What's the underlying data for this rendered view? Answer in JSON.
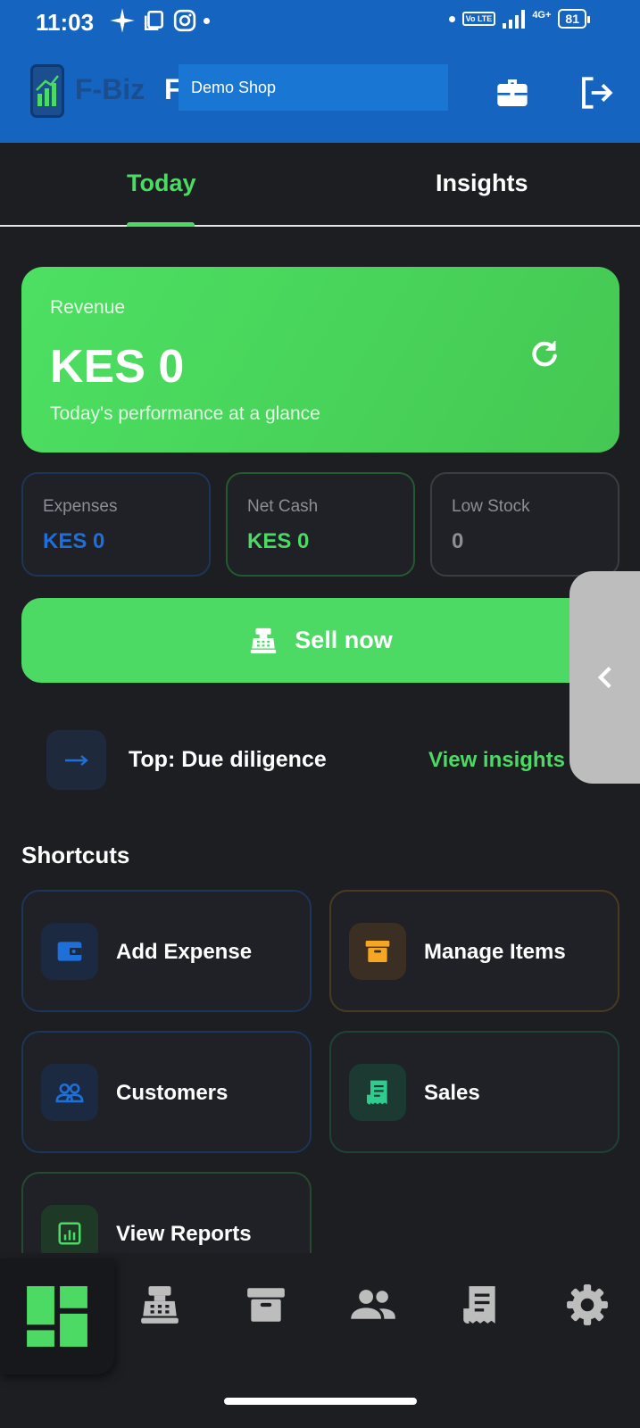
{
  "status_bar": {
    "time": "11:03",
    "volte_label": "Vo LTE",
    "network": "4G+",
    "battery": "81"
  },
  "app_bar": {
    "logo_text": "F-Biz",
    "title_initial": "F",
    "shop_name": "Demo Shop",
    "actions": [
      "briefcase-icon",
      "logout-icon"
    ]
  },
  "tabs": [
    {
      "label": "Today",
      "active": true
    },
    {
      "label": "Insights",
      "active": false
    }
  ],
  "revenue": {
    "label": "Revenue",
    "value": "KES 0",
    "subtitle": "Today's performance at a glance"
  },
  "stats": [
    {
      "label": "Expenses",
      "value": "KES 0",
      "color": "#1e6fd9"
    },
    {
      "label": "Net Cash",
      "value": "KES 0",
      "color": "#4cd964"
    },
    {
      "label": "Low Stock",
      "value": "0",
      "color": "#8a8f96"
    }
  ],
  "sell_button": {
    "label": "Sell now"
  },
  "top_item": {
    "text": "Top: Due diligence",
    "link": "View insights"
  },
  "shortcuts": {
    "title": "Shortcuts",
    "items": [
      {
        "label": "Add Expense",
        "icon": "wallet-icon"
      },
      {
        "label": "Manage Items",
        "icon": "archive-box-icon"
      },
      {
        "label": "Customers",
        "icon": "people-icon"
      },
      {
        "label": "Sales",
        "icon": "receipt-icon"
      },
      {
        "label": "View Reports",
        "icon": "report-chart-icon"
      }
    ]
  },
  "bottom_nav": [
    "dashboard-icon",
    "cash-register-icon",
    "archive-box-icon",
    "people-icon",
    "receipt-icon",
    "gear-icon"
  ],
  "colors": {
    "brand_blue": "#1565c0",
    "accent_green": "#4cd964",
    "expense_blue": "#1e6fd9",
    "items_orange": "#f5a623",
    "background": "#1c1e22"
  }
}
